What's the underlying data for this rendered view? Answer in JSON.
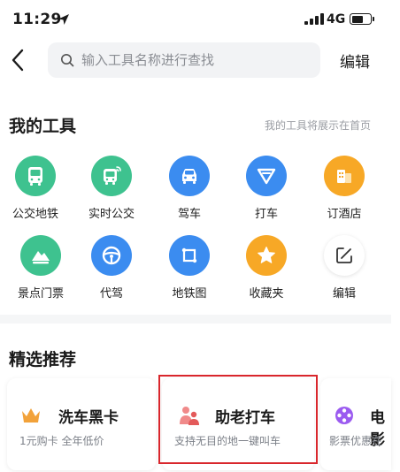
{
  "status_bar": {
    "time": "11:29",
    "network": "4G",
    "battery_level": 0.6
  },
  "header": {
    "search_placeholder": "输入工具名称进行查找",
    "edit_label": "编辑"
  },
  "my_tools": {
    "title": "我的工具",
    "hint": "我的工具将展示在首页",
    "items": [
      {
        "label": "公交地铁",
        "icon": "bus-icon",
        "color": "#3ec28f"
      },
      {
        "label": "实时公交",
        "icon": "realtime-bus-icon",
        "color": "#3ec28f"
      },
      {
        "label": "驾车",
        "icon": "car-icon",
        "color": "#3b8cf0"
      },
      {
        "label": "打车",
        "icon": "taxi-icon",
        "color": "#3b8cf0"
      },
      {
        "label": "订酒店",
        "icon": "hotel-icon",
        "color": "#f7a826"
      },
      {
        "label": "景点门票",
        "icon": "scenic-ticket-icon",
        "color": "#3ec28f"
      },
      {
        "label": "代驾",
        "icon": "steering-wheel-icon",
        "color": "#3b8cf0"
      },
      {
        "label": "地铁图",
        "icon": "subway-map-icon",
        "color": "#3b8cf0"
      },
      {
        "label": "收藏夹",
        "icon": "star-icon",
        "color": "#f7a826"
      },
      {
        "label": "编辑",
        "icon": "edit-icon",
        "color": "#ffffff"
      }
    ]
  },
  "recommend": {
    "title": "精选推荐",
    "cards": [
      {
        "title": "洗车黑卡",
        "subtitle": "1元购卡 全年低价",
        "icon": "crown-icon",
        "color": "#f2a23a"
      },
      {
        "title": "助老打车",
        "subtitle": "支持无目的地一键叫车",
        "icon": "elderly-people-icon",
        "color": "#f06b6b"
      },
      {
        "title": "电影",
        "subtitle": "影票优惠在",
        "icon": "film-reel-icon",
        "color": "#9b5bf0"
      }
    ]
  }
}
